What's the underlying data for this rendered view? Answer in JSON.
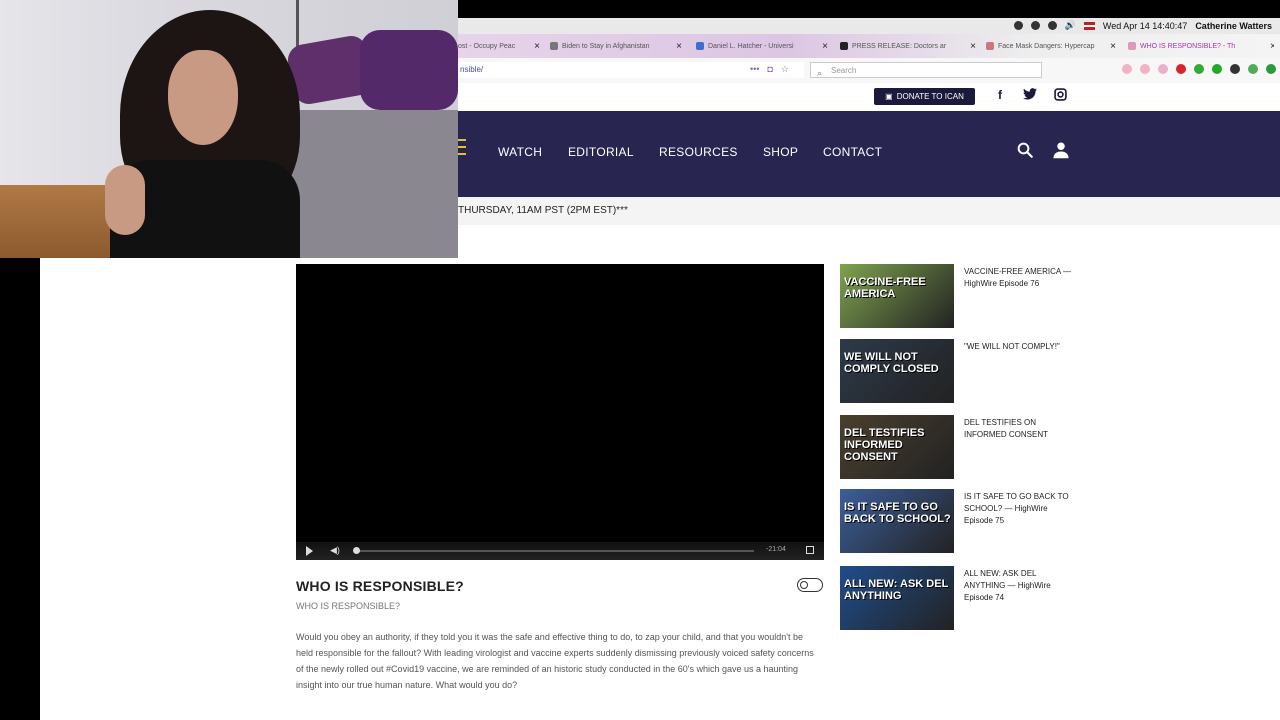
{
  "menubar": {
    "clock": "Wed Apr 14  14:40:47",
    "user": "Catherine Watters"
  },
  "tabs": [
    {
      "label": "ost - Occupy Peac"
    },
    {
      "label": "Biden to Stay in Afghanistan"
    },
    {
      "label": "Daniel L. Hatcher - Universi"
    },
    {
      "label": "PRESS RELEASE: Doctors ar"
    },
    {
      "label": "Face Mask Dangers: Hypercap"
    },
    {
      "label": "WHO IS RESPONSIBLE? - Th"
    }
  ],
  "address": {
    "url": "nsible/",
    "search_placeholder": "Search",
    "dots": "•••"
  },
  "site": {
    "donate_label": "DONATE TO ICAN",
    "social": [
      "f",
      "t",
      "ig"
    ],
    "nav": [
      "WATCH",
      "EDITORIAL",
      "RESOURCES",
      "SHOP",
      "CONTACT"
    ],
    "banner": "THURSDAY, 11AM PST (2PM EST)***"
  },
  "video": {
    "time": "-21:04",
    "progress": 0.005
  },
  "post": {
    "title": "WHO IS RESPONSIBLE?",
    "subtitle": "WHO IS RESPONSIBLE?",
    "body": "Would you obey an authority, if they told you it was the safe and effective thing to do, to zap your child, and that you wouldn't be held responsible for the fallout? With leading virologist and vaccine experts suddenly dismissing previously voiced safety concerns of the newly rolled out #Covid19 vaccine, we are reminded of an historic study conducted in the 60's which gave us a haunting insight into our true human nature. What would you do?"
  },
  "sidebar": [
    {
      "label": "VACCINE-FREE AMERICA — HighWire Episode 76",
      "thumb_text": "VACCINE-FREE AMERICA",
      "bg": "#7fa34f"
    },
    {
      "label": "\"WE WILL NOT COMPLY!\"",
      "thumb_text": "WE WILL NOT COMPLY CLOSED",
      "bg": "#2d3a4a"
    },
    {
      "label": "DEL TESTIFIES ON INFORMED CONSENT",
      "thumb_text": "DEL TESTIFIES INFORMED CONSENT",
      "bg": "#4a3f2e"
    },
    {
      "label": "IS IT SAFE TO GO BACK TO SCHOOL? — HighWire Episode 75",
      "thumb_text": "IS IT SAFE TO GO BACK TO SCHOOL?",
      "bg": "#3b5e9a"
    },
    {
      "label": "ALL NEW: ASK DEL ANYTHING — HighWire Episode 74",
      "thumb_text": "ALL NEW: ASK DEL ANYTHING",
      "bg": "#1f4d8c"
    }
  ],
  "colors": {
    "nav_bg": "#282650",
    "accent": "#e6c12b"
  }
}
